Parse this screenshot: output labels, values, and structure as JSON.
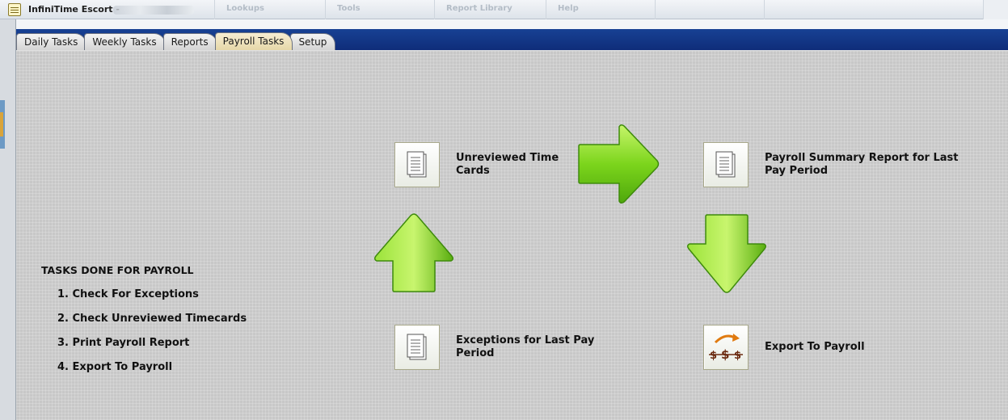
{
  "window": {
    "title": "InfiniTime Escort -",
    "menu": [
      "Lookups",
      "Tools",
      "Report Library",
      "Help"
    ]
  },
  "tabs": [
    {
      "label": "Daily Tasks",
      "active": false
    },
    {
      "label": "Weekly Tasks",
      "active": false
    },
    {
      "label": "Reports",
      "active": false
    },
    {
      "label": "Payroll Tasks",
      "active": true
    },
    {
      "label": "Setup",
      "active": false
    }
  ],
  "workflow": {
    "unreviewed": {
      "label_line1": "Unreviewed Time",
      "label_line2": "Cards",
      "icon": "document-icon"
    },
    "summary": {
      "label_line1": "Payroll Summary Report for Last",
      "label_line2": "Pay Period",
      "icon": "document-icon"
    },
    "exceptions": {
      "label_line1": "Exceptions for Last Pay",
      "label_line2": "Period",
      "icon": "document-icon"
    },
    "export": {
      "label_line1": "Export To Payroll",
      "label_line2": "",
      "icon": "money-transfer-icon"
    },
    "arrow_color": "#6fd11e"
  },
  "tasks_list": {
    "title": "TASKS DONE FOR PAYROLL",
    "items": [
      "1. Check For Exceptions",
      "2. Check Unreviewed Timecards",
      "3. Print Payroll Report",
      "4. Export To Payroll"
    ]
  }
}
